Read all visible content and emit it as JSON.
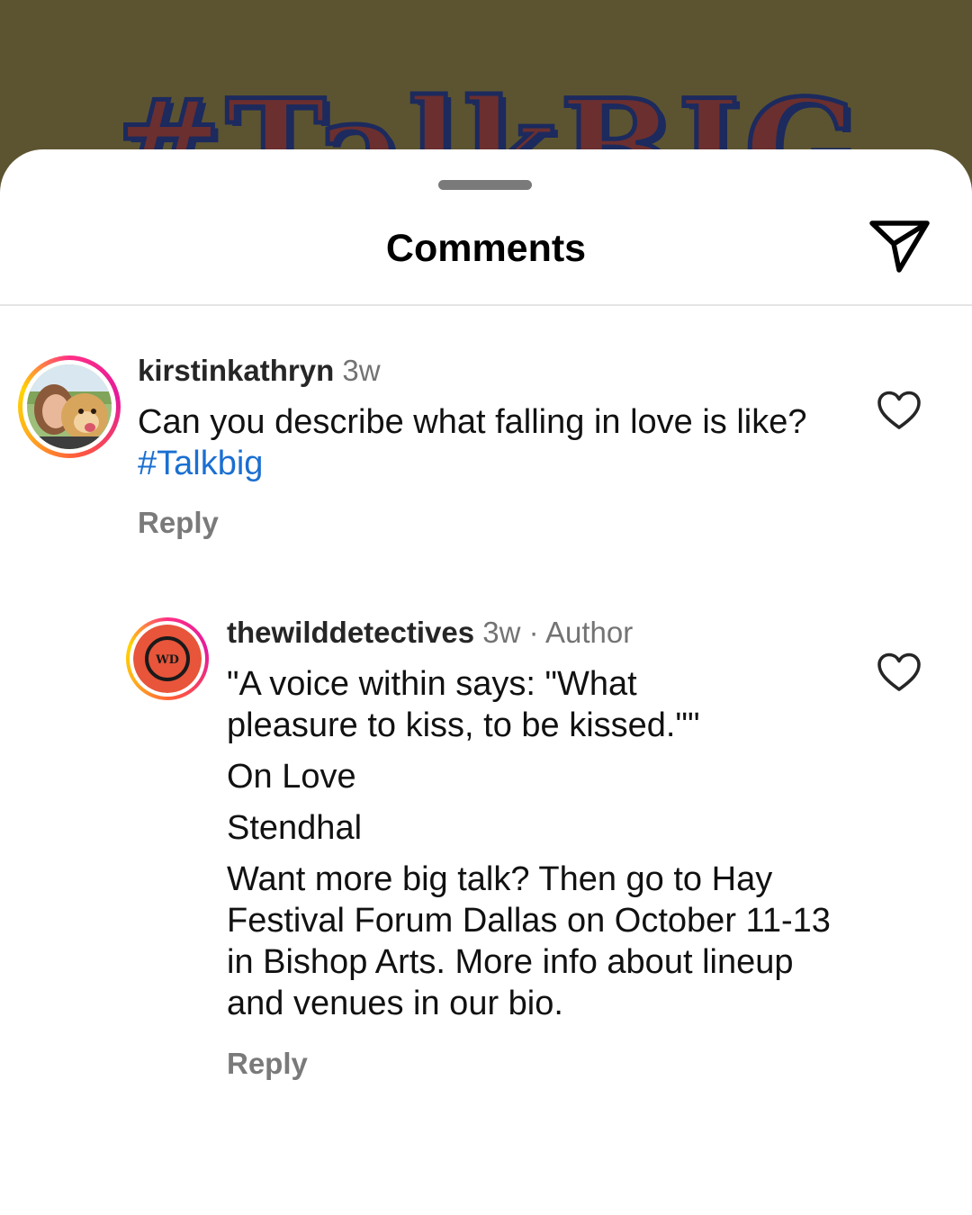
{
  "backdrop": {
    "title": "#TalkBIG"
  },
  "sheet": {
    "title": "Comments",
    "share_icon": "paper-plane-icon"
  },
  "comments": [
    {
      "username": "kirstinkathryn",
      "time": "3w",
      "text_prefix": "Can you describe what falling in love is like? ",
      "hashtag": "#Talkbig",
      "reply_label": "Reply",
      "like_icon": "heart-icon"
    },
    {
      "username": "thewilddetectives",
      "time": "3w",
      "separator": " · ",
      "badge": "Author",
      "avatar_logo_text": "WD",
      "lines": [
        "\"A voice within says: \"What pleasure to kiss, to be kissed.\"\"",
        "On Love",
        "Stendhal",
        "Want more big talk? Then go to Hay Festival Forum Dallas on October 11-13 in Bishop Arts. More info about lineup and venues in our bio."
      ],
      "reply_label": "Reply",
      "like_icon": "heart-icon"
    }
  ],
  "colors": {
    "backdrop": "#5c5430",
    "hashtag": "#1a6fd1",
    "logo_orange": "#e8553a"
  }
}
